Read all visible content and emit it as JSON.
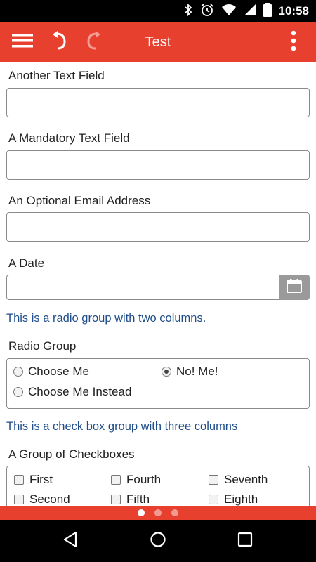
{
  "status_bar": {
    "time": "10:58",
    "icons": [
      "bluetooth-icon",
      "alarm-icon",
      "wifi-icon",
      "signal-icon",
      "battery-icon"
    ]
  },
  "app_bar": {
    "title": "Test",
    "background": "#e8402f",
    "icons": [
      "menu-icon",
      "undo-icon",
      "redo-icon",
      "overflow-menu-icon"
    ]
  },
  "form": {
    "another_text_field": {
      "label": "Another Text Field",
      "value": ""
    },
    "mandatory_text_field": {
      "label": "A Mandatory Text Field",
      "value": ""
    },
    "optional_email": {
      "label": "An Optional Email Address",
      "value": ""
    },
    "date": {
      "label": "A Date",
      "value": ""
    },
    "radio_info": "This is a radio group with two columns.",
    "radio_group": {
      "label": "Radio Group",
      "options": [
        "Choose Me",
        "No! Me!",
        "Choose Me Instead"
      ],
      "selected": "No! Me!"
    },
    "checkbox_info": "This is a check box group with three columns",
    "checkbox_group": {
      "label": "A Group of Checkboxes",
      "options": [
        "First",
        "Fourth",
        "Seventh",
        "Second",
        "Fifth",
        "Eighth"
      ]
    }
  },
  "pager": {
    "pages": 3,
    "active": 1
  },
  "nav_bar": {
    "icons": [
      "back-icon",
      "home-icon",
      "recents-icon"
    ]
  }
}
